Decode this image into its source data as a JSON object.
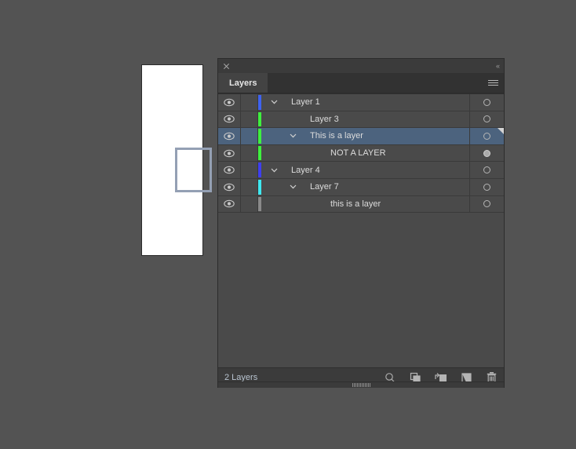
{
  "app": {
    "background_color": "#535353"
  },
  "canvas": {
    "artboard_name": "artboard",
    "artboard_color": "#ffffff",
    "shape_name": "rectangle-outline",
    "shape_stroke_color": "#94a0b4"
  },
  "panel": {
    "close_icon": "close-icon",
    "collapse_icon": "collapse-chevrons",
    "collapse_glyph": "«",
    "menu_icon": "panel-menu-icon",
    "tabs": [
      {
        "label": "Layers",
        "active": true
      }
    ],
    "selected_row_color": "#4c637e",
    "rows": [
      {
        "name": "Layer 1",
        "indent": 0,
        "swatch_color": "#3f63f0",
        "has_disclosure": true,
        "disclosure_indent": 0,
        "selected": false,
        "target_filled": false,
        "visible": true
      },
      {
        "name": "Layer 3",
        "indent": 1,
        "swatch_color": "#3ff03f",
        "has_disclosure": false,
        "disclosure_indent": 1,
        "selected": false,
        "target_filled": false,
        "visible": true
      },
      {
        "name": "This is a layer",
        "indent": 1,
        "swatch_color": "#3ff03f",
        "has_disclosure": true,
        "disclosure_indent": 1,
        "selected": true,
        "target_filled": false,
        "visible": true
      },
      {
        "name": "NOT A LAYER",
        "indent": 2,
        "swatch_color": "#3ff03f",
        "has_disclosure": false,
        "disclosure_indent": 2,
        "selected": false,
        "target_filled": true,
        "visible": true
      },
      {
        "name": "Layer 4",
        "indent": 0,
        "swatch_color": "#3f3ff0",
        "has_disclosure": true,
        "disclosure_indent": 0,
        "selected": false,
        "target_filled": false,
        "visible": true
      },
      {
        "name": "Layer 7",
        "indent": 1,
        "swatch_color": "#3fe8f0",
        "has_disclosure": true,
        "disclosure_indent": 1,
        "selected": false,
        "target_filled": false,
        "visible": true
      },
      {
        "name": "this is a layer",
        "indent": 2,
        "swatch_color": "#8a8a8a",
        "has_disclosure": false,
        "disclosure_indent": 2,
        "selected": false,
        "target_filled": false,
        "visible": true
      }
    ],
    "footer": {
      "count_label": "2 Layers",
      "icons": [
        {
          "name": "locate-object-icon",
          "title": "Locate Object"
        },
        {
          "name": "make-sublayer-icon",
          "title": "Make/Release Clipping Mask"
        },
        {
          "name": "create-new-sublayer-icon",
          "title": "Create New Sublayer"
        },
        {
          "name": "create-new-layer-icon",
          "title": "Create New Layer"
        },
        {
          "name": "delete-selection-icon",
          "title": "Delete Selection"
        }
      ]
    },
    "resize_grip": "resize-grip"
  }
}
